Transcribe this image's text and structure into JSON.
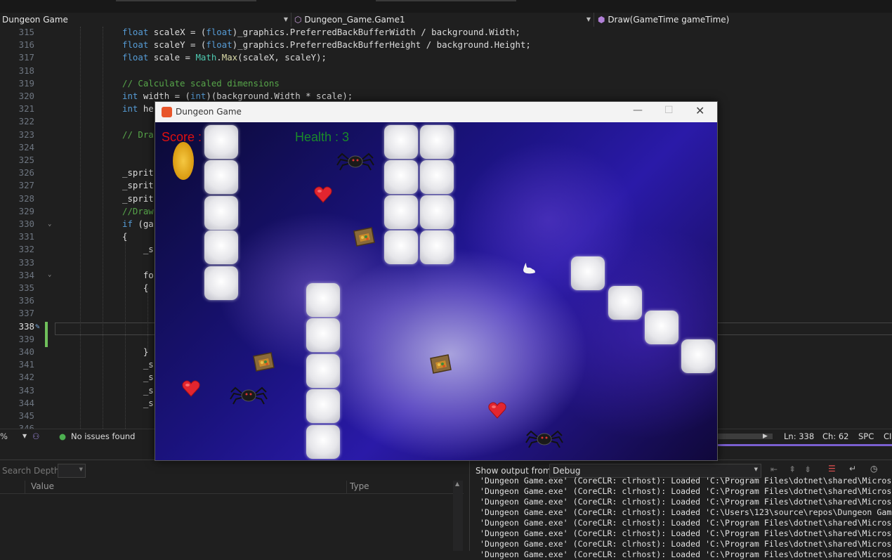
{
  "nav": {
    "project": "Dungeon Game",
    "class_name": "Dungeon_Game.Game1",
    "method": "Draw(GameTime gameTime)"
  },
  "editor": {
    "lines": [
      {
        "num": "315",
        "code": "float scaleX = (float)_graphics.PreferredBackBufferWidth / background.Width;"
      },
      {
        "num": "316",
        "code": "float scaleY = (float)_graphics.PreferredBackBufferHeight / background.Height;"
      },
      {
        "num": "317",
        "code": "float scale = Math.Max(scaleX, scaleY);"
      },
      {
        "num": "318",
        "code": ""
      },
      {
        "num": "319",
        "code": "// Calculate scaled dimensions"
      },
      {
        "num": "320",
        "code": "int width = (int)(background.Width * scale);"
      },
      {
        "num": "321",
        "code": "int he"
      },
      {
        "num": "322",
        "code": ""
      },
      {
        "num": "323",
        "code": "// Dra"
      },
      {
        "num": "324",
        "code": ""
      },
      {
        "num": "325",
        "code": ""
      },
      {
        "num": "326",
        "code": "_sprit"
      },
      {
        "num": "327",
        "code": "_sprit"
      },
      {
        "num": "328",
        "code": "_sprit"
      },
      {
        "num": "329",
        "code": "//Draw"
      },
      {
        "num": "330",
        "code": "if (ga"
      },
      {
        "num": "331",
        "code": "{"
      },
      {
        "num": "332",
        "code": "    _s"
      },
      {
        "num": "333",
        "code": ""
      },
      {
        "num": "334",
        "code": "    fo"
      },
      {
        "num": "335",
        "code": "    {"
      },
      {
        "num": "336",
        "code": ""
      },
      {
        "num": "337",
        "code": ""
      },
      {
        "num": "338",
        "code": ""
      },
      {
        "num": "339",
        "code": ""
      },
      {
        "num": "340",
        "code": "    }"
      },
      {
        "num": "341",
        "code": "    _s"
      },
      {
        "num": "342",
        "code": "    _s"
      },
      {
        "num": "343",
        "code": "    _s"
      },
      {
        "num": "344",
        "code": "    _s"
      },
      {
        "num": "345",
        "code": ""
      },
      {
        "num": "346",
        "code": ""
      }
    ]
  },
  "status": {
    "zoom": "%",
    "issues": "No issues found",
    "line": "Ln: 338",
    "col": "Ch: 62",
    "spacing": "SPC",
    "extra": "CI"
  },
  "locals": {
    "search_depth_label": "Search Depth:",
    "col_value": "Value",
    "col_type": "Type"
  },
  "output": {
    "show_from_label": "Show output from:",
    "source": "Debug",
    "lines": [
      "'Dungeon Game.exe' (CoreCLR: clrhost): Loaded 'C:\\Program Files\\dotnet\\shared\\Micros",
      "'Dungeon Game.exe' (CoreCLR: clrhost): Loaded 'C:\\Program Files\\dotnet\\shared\\Micros",
      "'Dungeon Game.exe' (CoreCLR: clrhost): Loaded 'C:\\Program Files\\dotnet\\shared\\Micros",
      "'Dungeon Game.exe' (CoreCLR: clrhost): Loaded 'C:\\Users\\123\\source\\repos\\Dungeon Gam",
      "'Dungeon Game.exe' (CoreCLR: clrhost): Loaded 'C:\\Program Files\\dotnet\\shared\\Micros",
      "'Dungeon Game.exe' (CoreCLR: clrhost): Loaded 'C:\\Program Files\\dotnet\\shared\\Micros",
      "'Dungeon Game.exe' (CoreCLR: clrhost): Loaded 'C:\\Program Files\\dotnet\\shared\\Micros",
      "'Dungeon Game.exe' (CoreCLR: clrhost): Loaded 'C:\\Program Files\\dotnet\\shared\\Micros"
    ]
  },
  "game": {
    "title": "Dungeon Game",
    "score": "Score : 0",
    "health": "Health : 3",
    "colors": {
      "score": "#e01010",
      "health": "#1a8a2a"
    }
  }
}
